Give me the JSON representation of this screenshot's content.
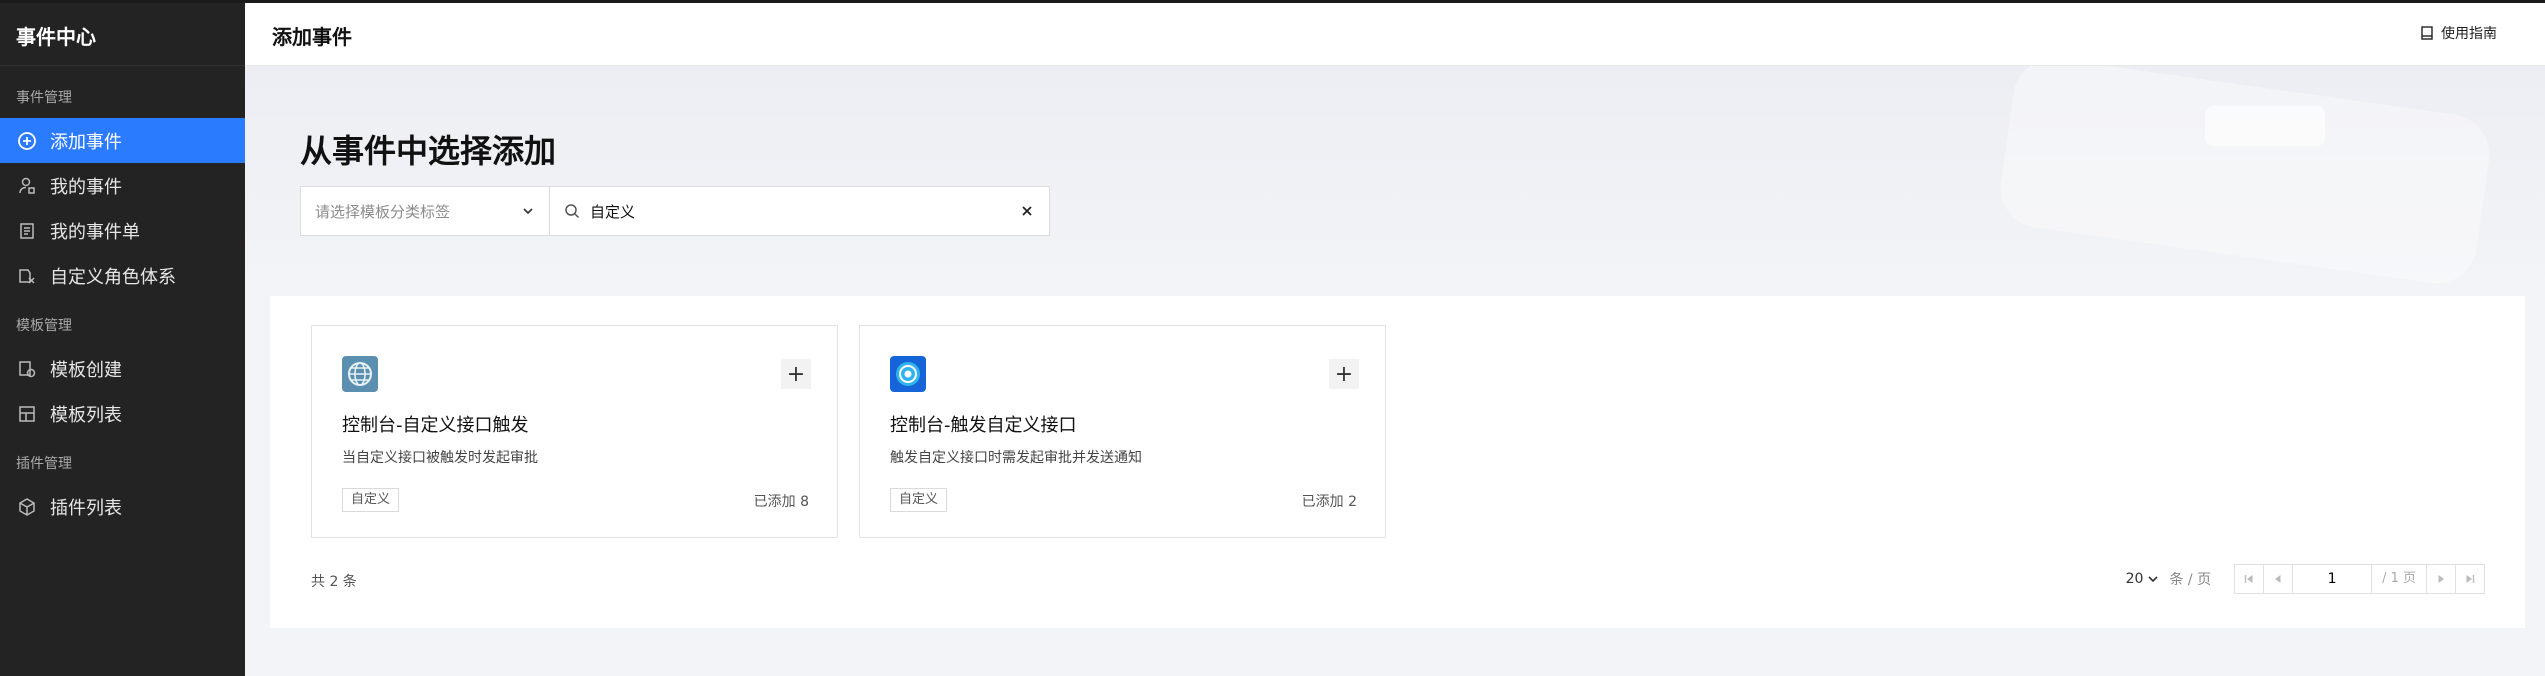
{
  "sidebar": {
    "title": "事件中心",
    "groups": [
      {
        "label": "事件管理",
        "items": [
          {
            "label": "添加事件",
            "icon": "plus-circle-icon",
            "active": true
          },
          {
            "label": "我的事件",
            "icon": "user-icon"
          },
          {
            "label": "我的事件单",
            "icon": "document-icon"
          },
          {
            "label": "自定义角色体系",
            "icon": "role-icon"
          }
        ]
      },
      {
        "label": "模板管理",
        "items": [
          {
            "label": "模板创建",
            "icon": "template-create-icon"
          },
          {
            "label": "模板列表",
            "icon": "template-list-icon"
          }
        ]
      },
      {
        "label": "插件管理",
        "items": [
          {
            "label": "插件列表",
            "icon": "cube-icon"
          }
        ]
      }
    ]
  },
  "header": {
    "title": "添加事件",
    "guide_label": "使用指南"
  },
  "hero": {
    "title": "从事件中选择添加",
    "category_placeholder": "请选择模板分类标签",
    "search_value": "自定义"
  },
  "cards": [
    {
      "title": "控制台-自定义接口触发",
      "desc": "当自定义接口被触发时发起审批",
      "tag": "自定义",
      "count": "已添加 8"
    },
    {
      "title": "控制台-触发自定义接口",
      "desc": "触发自定义接口时需发起审批并发送通知",
      "tag": "自定义",
      "count": "已添加 2"
    }
  ],
  "pagination": {
    "total": "共 2 条",
    "page_size": "20",
    "unit": "条 / 页",
    "current": "1",
    "pages": "/ 1 页"
  },
  "colors": {
    "accent": "#2b7bff",
    "sidebar_bg": "#232323"
  }
}
